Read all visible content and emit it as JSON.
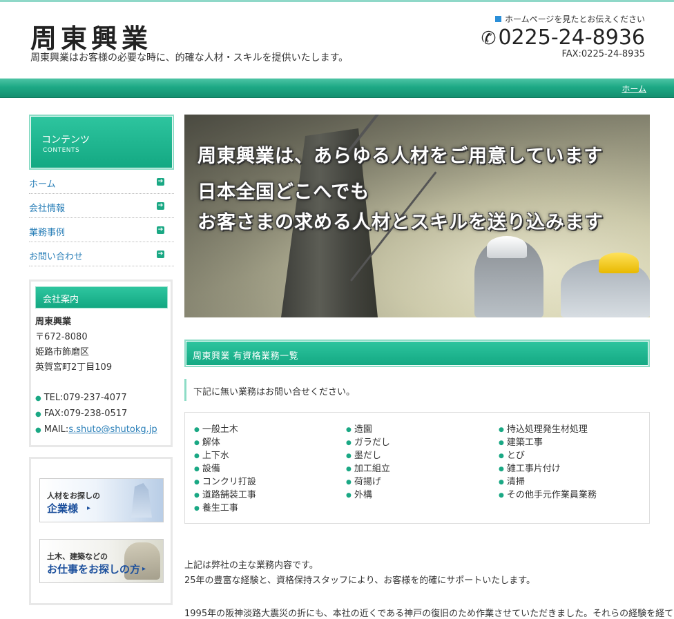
{
  "header": {
    "logo": "周東興業",
    "tagline": "周東興業はお客様の必要な時に、的確な人材・スキルを提供いたします。",
    "contact_note": "ホームページを見たとお伝えください",
    "phone": "0225-24-8936",
    "fax": "FAX:0225-24-8935"
  },
  "nav": {
    "home_link": "ホーム"
  },
  "sidebar": {
    "contents_jp": "コンテンツ",
    "contents_en": "CONTENTS",
    "menu": [
      "ホーム",
      "会社情報",
      "業務事例",
      "お問い合わせ"
    ],
    "company": {
      "heading": "会社案内",
      "name": "周東興業",
      "postal": "〒672-8080",
      "addr1": "姫路市飾磨区",
      "addr2": "英賀宮町2丁目109",
      "tel": "TEL:079-237-4077",
      "fax": "FAX:079-238-0517",
      "mail_label": "MAIL:",
      "mail": "s.shuto@shutokg.jp"
    },
    "banners": {
      "b1_small": "人材をお探しの",
      "b1_big": "企業様",
      "b2_small": "土木、建築などの",
      "b2_big": "お仕事をお探しの方"
    }
  },
  "hero": {
    "line1": "周東興業は、あらゆる人材をご用意しています",
    "line2": "日本全国どこへでも",
    "line3": "お客さまの求める人材とスキルを送り込みます"
  },
  "section": {
    "title": "周東興業 有資格業務一覧",
    "note": "下記に無い業務はお問い合せください。",
    "col1": [
      "一般土木",
      "解体",
      "上下水",
      "設備",
      "コンクリ打設",
      "道路舗装工事",
      "養生工事"
    ],
    "col2": [
      "造園",
      "ガラだし",
      "墨だし",
      "加工組立",
      "荷揚げ",
      "外構"
    ],
    "col3": [
      "持込処理発生材処理",
      "建築工事",
      "とび",
      "雑工事片付け",
      "清掃",
      "その他手元作業員業務"
    ],
    "para1": "上記は弊社の主な業務内容です。",
    "para2": "25年の豊富な経験と、資格保持スタッフにより、お客様を的確にサポートいたします。",
    "para3": "1995年の阪神淡路大震災の折にも、本社の近くである神戸の復旧のため作業させていただきました。それらの経験を経て"
  },
  "colors": {
    "accent": "#1aa884",
    "link": "#2a7fb8"
  }
}
